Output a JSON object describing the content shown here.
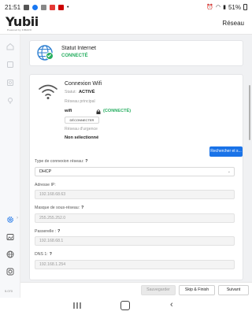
{
  "status_bar": {
    "time": "21:51",
    "battery": "51%"
  },
  "header": {
    "logo": "Yubii",
    "logo_sub": "Powered by FIBARO",
    "title": "Réseau"
  },
  "sidebar": {
    "version": "5.070"
  },
  "internet_card": {
    "title": "Statut Internet",
    "status": "CONNECTÉ"
  },
  "wifi_card": {
    "title": "Connexion Wifi",
    "status_label": "Statut:",
    "status_value": "ACTIVÉ",
    "main_network_label": "Réseau principal",
    "network_name": "wifi",
    "connected": "(CONNECTÉ)",
    "disconnect_button": "DÉCONNECTER",
    "emergency_network_label": "Réseau d'urgence",
    "emergency_network_value": "Non sélectionné",
    "search_button": "Rechercher et s..."
  },
  "network_form": {
    "connection_type_label": "Type de connexion réseau:",
    "connection_type_value": "DHCP",
    "ip_label": "Adresse IP:",
    "ip_value": "192.168.68.63",
    "mask_label": "Masque de sous-réseau:",
    "mask_value": "255.255.252.0",
    "gateway_label": "Passerelle :",
    "gateway_value": "192.168.68.1",
    "dns_label": "DNS 1:",
    "dns_value": "192.168.1.254",
    "help_mark": "?"
  },
  "bottom_bar": {
    "save": "Sauvegarder",
    "skip": "Skip & Finish",
    "next": "Suivant"
  },
  "colors": {
    "accent": "#1a73e8",
    "success": "#27ae60"
  }
}
